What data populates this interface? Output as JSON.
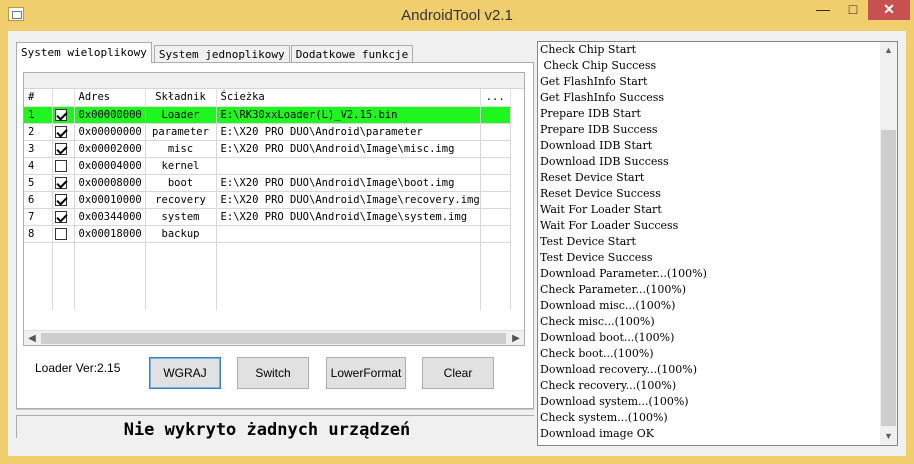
{
  "window": {
    "title": "AndroidTool v2.1",
    "minimize": "—",
    "maximize": "□",
    "close": "✕"
  },
  "tabs": [
    {
      "label": "System wieloplikowy",
      "active": true
    },
    {
      "label": "System jednoplikowy",
      "active": false
    },
    {
      "label": "Dodatkowe funkcje",
      "active": false
    }
  ],
  "table": {
    "headers": {
      "num": "#",
      "addr": "Adres",
      "name": "Składnik",
      "path": "Ścieżka",
      "more": "..."
    },
    "rows": [
      {
        "num": "1",
        "checked": true,
        "addr": "0x00000000",
        "name": "Loader",
        "path": "E:\\RK30xxLoader(L)_V2.15.bin",
        "selected": true
      },
      {
        "num": "2",
        "checked": true,
        "addr": "0x00000000",
        "name": "parameter",
        "path": "E:\\X20 PRO DUO\\Android\\parameter"
      },
      {
        "num": "3",
        "checked": true,
        "addr": "0x00002000",
        "name": "misc",
        "path": "E:\\X20 PRO DUO\\Android\\Image\\misc.img"
      },
      {
        "num": "4",
        "checked": false,
        "addr": "0x00004000",
        "name": "kernel",
        "path": ""
      },
      {
        "num": "5",
        "checked": true,
        "addr": "0x00008000",
        "name": "boot",
        "path": "E:\\X20 PRO DUO\\Android\\Image\\boot.img"
      },
      {
        "num": "6",
        "checked": true,
        "addr": "0x00010000",
        "name": "recovery",
        "path": "E:\\X20 PRO DUO\\Android\\Image\\recovery.img"
      },
      {
        "num": "7",
        "checked": true,
        "addr": "0x00344000",
        "name": "system",
        "path": "E:\\X20 PRO DUO\\Android\\Image\\system.img"
      },
      {
        "num": "8",
        "checked": false,
        "addr": "0x00018000",
        "name": "backup",
        "path": ""
      }
    ]
  },
  "loader_version": "Loader Ver:2.15",
  "buttons": {
    "wgraj": "WGRAJ",
    "switch": "Switch",
    "lower_format": "LowerFormat",
    "clear": "Clear"
  },
  "status": "Nie wykryto żadnych urządzeń",
  "log": [
    "Check Chip Start",
    " Check Chip Success",
    "Get FlashInfo Start",
    "Get FlashInfo Success",
    "Prepare IDB Start",
    "Prepare IDB Success",
    "Download IDB Start",
    "Download IDB Success",
    "Reset Device Start",
    "Reset Device Success",
    "Wait For Loader Start",
    "Wait For Loader Success",
    "Test Device Start",
    "Test Device Success",
    "Download Parameter...(100%)",
    "Check Parameter...(100%)",
    "Download misc...(100%)",
    "Check misc...(100%)",
    "Download boot...(100%)",
    "Check boot...(100%)",
    "Download recovery...(100%)",
    "Check recovery...(100%)",
    "Download system...(100%)",
    "Check system...(100%)",
    "Download image OK"
  ],
  "colors": {
    "selected_row": "#1ff51f",
    "frame": "#f0ce6e",
    "close_button": "#c75050"
  }
}
